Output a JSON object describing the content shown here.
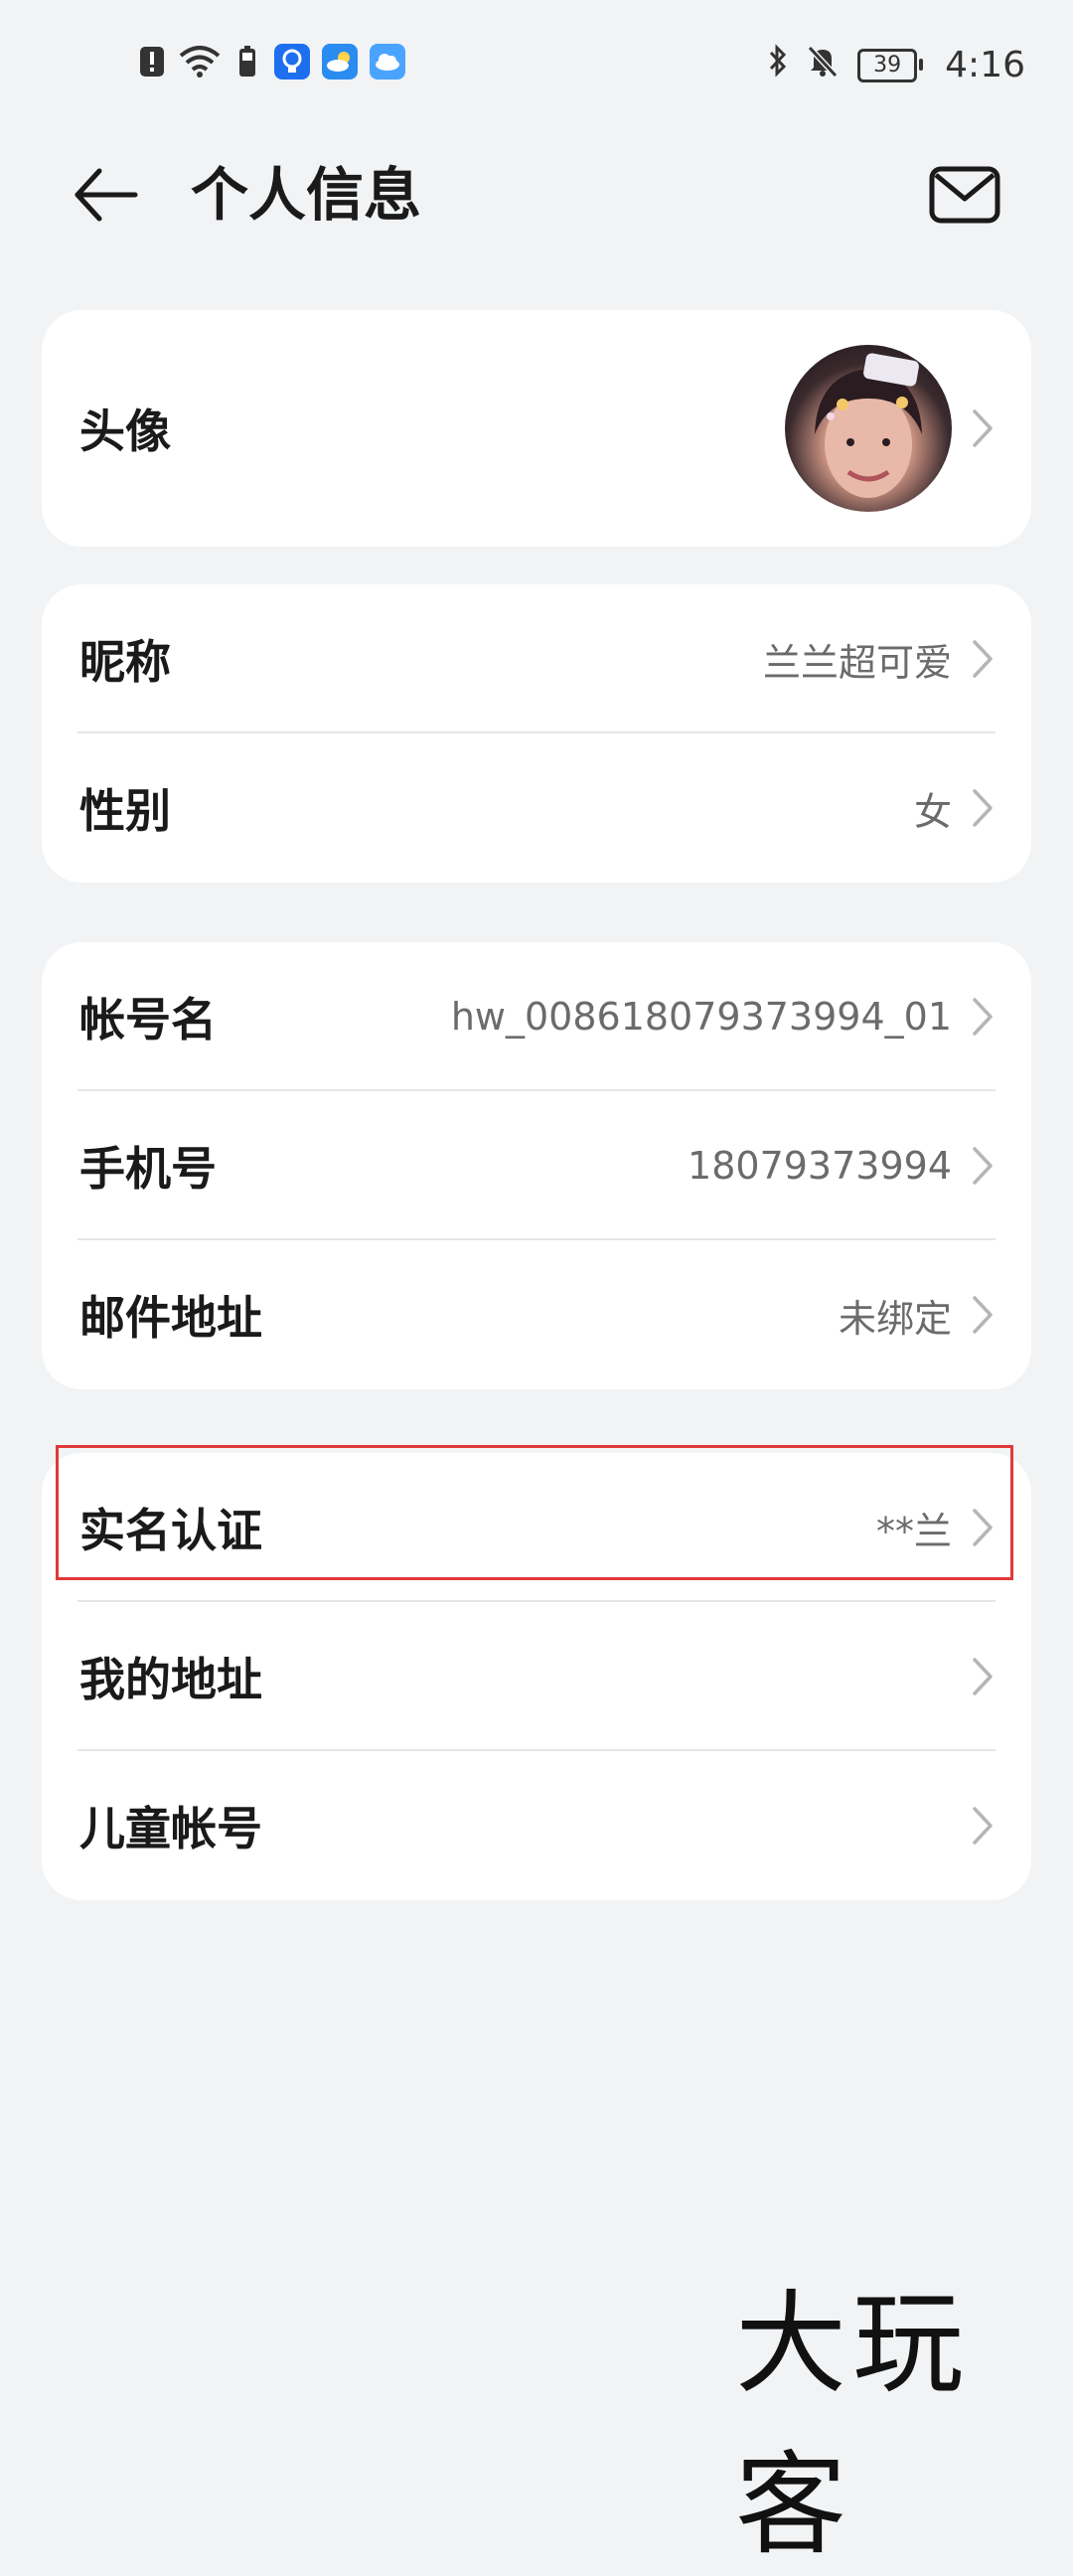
{
  "status_bar": {
    "time": "4:16",
    "battery_level": "39",
    "icons_left": [
      "notification-alert-icon",
      "wifi-icon",
      "battery-saver-icon",
      "app-tips-icon",
      "weather-icon",
      "cloud-icon"
    ],
    "icons_right": [
      "bluetooth-icon",
      "muted-bell-icon",
      "battery-icon"
    ]
  },
  "header": {
    "title": "个人信息"
  },
  "sections": {
    "avatar": {
      "label": "头像"
    },
    "profile": [
      {
        "label": "昵称",
        "value": "兰兰超可爱"
      },
      {
        "label": "性别",
        "value": "女"
      }
    ],
    "account": [
      {
        "label": "帐号名",
        "value": "hw_008618079373994_01"
      },
      {
        "label": "手机号",
        "value": "18079373994"
      },
      {
        "label": "邮件地址",
        "value": "未绑定"
      }
    ],
    "more": [
      {
        "label": "实名认证",
        "value": "**兰"
      },
      {
        "label": "我的地址",
        "value": ""
      },
      {
        "label": "儿童帐号",
        "value": ""
      }
    ]
  },
  "watermark": "大玩客",
  "colors": {
    "background": "#f1f3f5",
    "card": "#ffffff",
    "highlight_border": "#e0393b",
    "value_text": "#6b6b6b"
  }
}
